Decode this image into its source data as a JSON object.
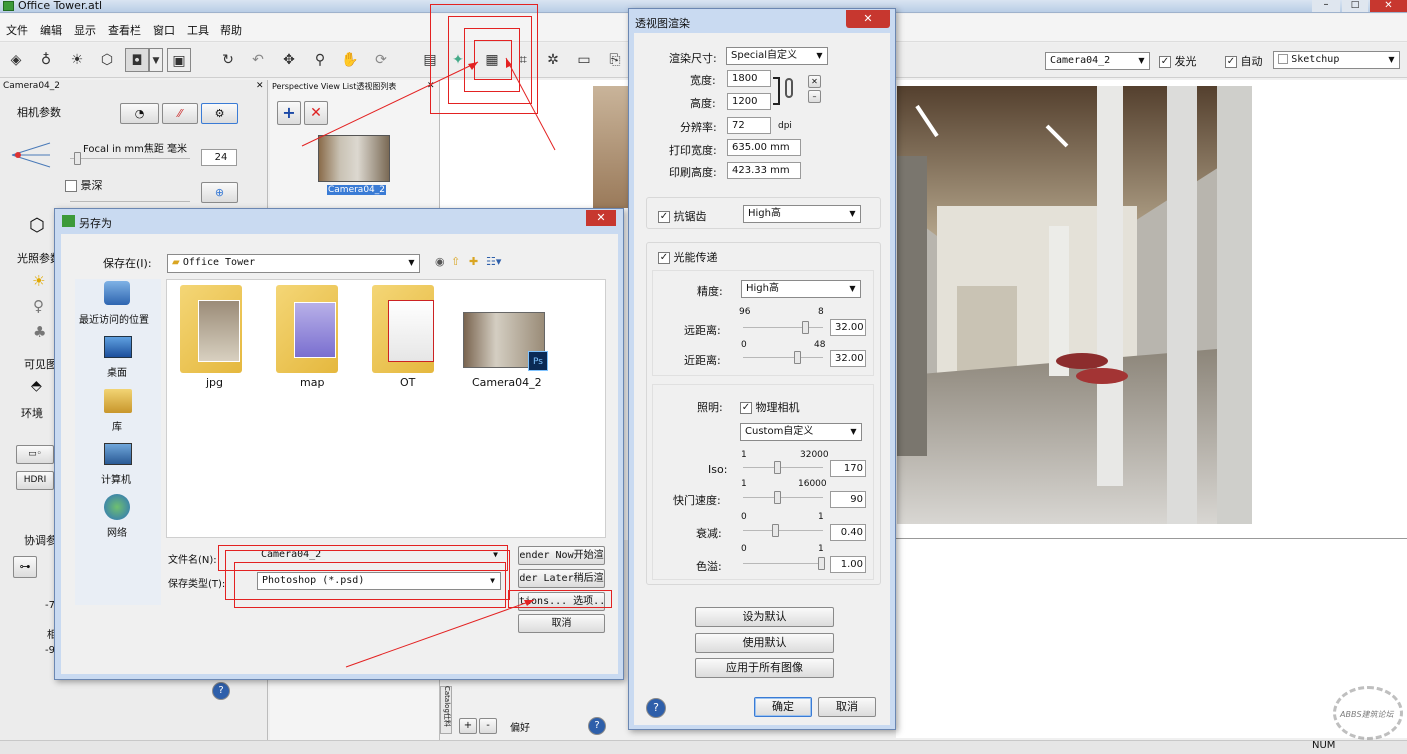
{
  "app": {
    "title": "Office Tower.atl",
    "icon": "app-logo-icon"
  },
  "menu": [
    "文件",
    "编辑",
    "显示",
    "查看栏",
    "窗口",
    "工具",
    "帮助"
  ],
  "toolbar": {
    "camera_select": "Camera04_2",
    "glow_label": "发光",
    "auto_label": "自动",
    "sketchup_select": "Sketchup"
  },
  "left_panel": {
    "title": "Camera04_2",
    "camera_params": "相机参数",
    "focal_label": "Focal in mm焦距 毫米",
    "focal_value": "24",
    "dof_label": "景深",
    "light_params": "光照参数",
    "visible": "可见图",
    "env": "环境",
    "hdri": "HDRI",
    "coord": "协调参",
    "val1": "-7",
    "val2": "-9",
    "lbl_xiang": "相"
  },
  "pv_panel": {
    "title": "Perspective View List透视图列表",
    "thumb_label": "Camera04_2",
    "catalog_tab": "Catalog仕料",
    "pref_label": "偏好",
    "plus": "+",
    "minus": "-"
  },
  "saveas": {
    "title": "另存为",
    "save_in_label": "保存在(I):",
    "save_in_value": "Office Tower",
    "places": [
      {
        "label": "最近访问的位置",
        "icon": "recent-places-icon"
      },
      {
        "label": "桌面",
        "icon": "desktop-icon"
      },
      {
        "label": "库",
        "icon": "library-icon"
      },
      {
        "label": "计算机",
        "icon": "computer-icon"
      },
      {
        "label": "网络",
        "icon": "network-icon"
      }
    ],
    "files": [
      {
        "name": "jpg",
        "kind": "folder"
      },
      {
        "name": "map",
        "kind": "folder"
      },
      {
        "name": "OT",
        "kind": "folder"
      },
      {
        "name": "Camera04_2",
        "kind": "psd"
      }
    ],
    "filename_label": "文件名(N):",
    "filename_value": "Camera04_2",
    "filetype_label": "保存类型(T):",
    "filetype_value": "Photoshop (*.psd)",
    "btn_now": "ender Now开始渲",
    "btn_later": "der Later稍后渲",
    "btn_options": "tions... 选项..",
    "btn_cancel": "取消"
  },
  "render": {
    "title": "透视图渲染",
    "size_label": "渲染尺寸:",
    "size_value": "Special自定义",
    "width_label": "宽度:",
    "width_value": "1800",
    "height_label": "高度:",
    "height_value": "1200",
    "res_label": "分辨率:",
    "res_value": "72",
    "res_unit": "dpi",
    "print_w_label": "打印宽度:",
    "print_w_value": "635.00 mm",
    "print_h_label": "印刷高度:",
    "print_h_value": "423.33 mm",
    "aa_label": "抗锯齿",
    "aa_value": "High高",
    "radiosity_label": "光能传递",
    "precision_label": "精度:",
    "precision_value": "High高",
    "far_label": "远距离:",
    "far_min": "96",
    "far_max": "8",
    "far_value": "32.00",
    "far_pos": 0.78,
    "near_label": "近距离:",
    "near_min": "0",
    "near_max": "48",
    "near_value": "32.00",
    "near_pos": 0.67,
    "lighting_label": "照明:",
    "physcam_label": "物理相机",
    "lighting_value": "Custom自定义",
    "iso_label": "Iso:",
    "iso_min": "1",
    "iso_max": "32000",
    "iso_value": "170",
    "iso_pos": 0.43,
    "shutter_label": "快门速度:",
    "shutter_min": "1",
    "shutter_max": "16000",
    "shutter_value": "90",
    "shutter_pos": 0.42,
    "falloff_label": "衰减:",
    "falloff_min": "0",
    "falloff_max": "1",
    "falloff_value": "0.40",
    "falloff_pos": 0.4,
    "tone_label": "色溢:",
    "tone_min": "0",
    "tone_max": "1",
    "tone_value": "1.00",
    "tone_pos": 0.97,
    "btn_set_default": "设为默认",
    "btn_use_default": "使用默认",
    "btn_apply_all": "应用于所有图像",
    "btn_ok": "确定",
    "btn_cancel": "取消"
  },
  "status": {
    "num": "NUM"
  },
  "watermark": "ABBS建筑论坛"
}
